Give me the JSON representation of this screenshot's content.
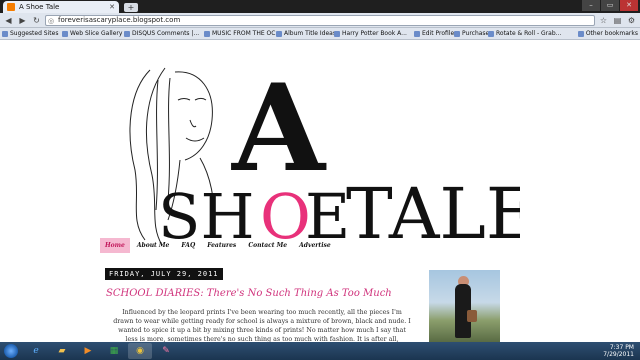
{
  "browser": {
    "tab_title": "A Shoe Tale",
    "new_tab": "+",
    "url": "foreverisascaryplace.blogspot.com",
    "window_controls": [
      "–",
      "▭",
      "✕"
    ]
  },
  "bookmarks": [
    "Suggested Sites",
    "Web Slice Gallery",
    "DISQUS Comments |...",
    "MUSIC FROM THE OC",
    "Album Title Ideas",
    "Harry Potter Book A...",
    "Edit Profile",
    "Purchase",
    "Rotate & Roll - Grab...",
    "Other bookmarks"
  ],
  "blog": {
    "logo_big_a": "A",
    "logo_shoe": "SH",
    "logo_o": "O",
    "logo_e": "E",
    "logo_tale": "TALE",
    "nav": [
      "Home",
      "About Me",
      "FAQ",
      "Features",
      "Contact Me",
      "Advertise"
    ],
    "post_date": "FRIDAY, JULY 29, 2011",
    "post_title": "SCHOOL DIARIES: There's No Such Thing As Too Much",
    "post_body": "Influenced by the leopard prints I've been wearing too much recently, all the pieces I'm drawn to wear while getting ready for school is always a mixture of brown, black and nude. I wanted to spice it up a bit by mixing three kinds of prints! No matter how much I say that less is more, sometimes there's no such thing as too much with fashion. It is after all, something that shouldn't be taken too seriously :)"
  },
  "taskbar": {
    "apps": [
      "ie-icon",
      "folder-icon",
      "media-icon",
      "excel-icon",
      "chrome-icon",
      "paint-icon"
    ],
    "time": "7:37 PM",
    "date": "7/29/2011"
  },
  "colors": {
    "accent_pink": "#d0337c",
    "nav_active_bg": "#f5b8d0"
  }
}
